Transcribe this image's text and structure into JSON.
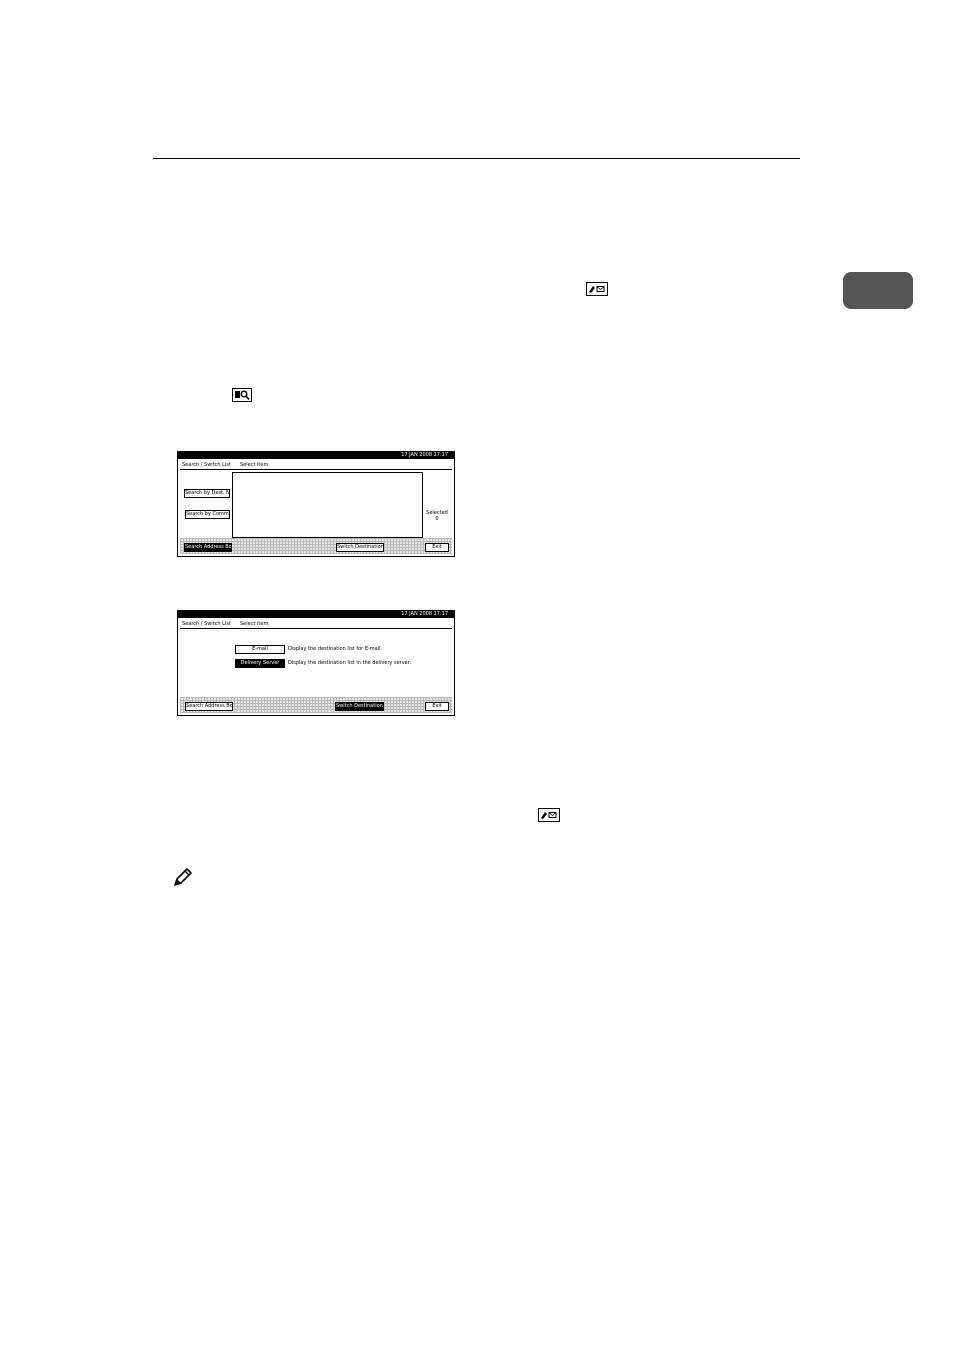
{
  "icons": {
    "tab_key": "addressbook-mail-key-icon",
    "search_key": "search-magnifier-key-icon",
    "note": "note-pencil-icon"
  },
  "screen1": {
    "datetime": "17 JAN 2008 17:17",
    "header_title": "Search / Switch List",
    "header_prompt": "Select item.",
    "btn_search_dest": "Search by Dest. Name",
    "btn_search_comment": "Search by Comment",
    "side_label": "Selected",
    "side_count": "0",
    "btn_search_address_book": "Search Address Book",
    "btn_switch_dest_list": "Switch Destination List",
    "btn_exit": "Exit"
  },
  "screen2": {
    "datetime": "17 JAN 2008 17:17",
    "header_title": "Search / Switch List",
    "header_prompt": "Select item.",
    "btn_email": "E-mail",
    "desc_email": "Display the destination list for E-mail.",
    "btn_delivery": "Delivery Server",
    "desc_delivery": "Display the destination list in the delivery server.",
    "btn_search_address_book": "Search Address Book",
    "btn_switch_dest_list": "Switch Destination List",
    "btn_exit": "Exit"
  }
}
